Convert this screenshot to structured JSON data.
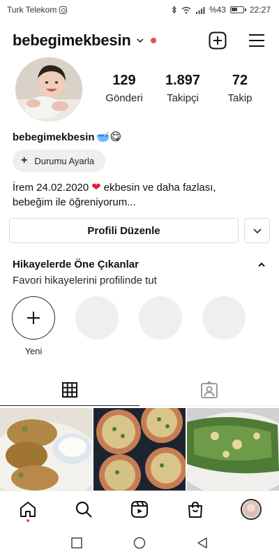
{
  "status_bar": {
    "carrier": "Turk Telekom",
    "battery": "%43",
    "time": "22:27"
  },
  "header": {
    "username": "bebegimekbesin"
  },
  "profile": {
    "stats": [
      {
        "value": "129",
        "label": "Gönderi"
      },
      {
        "value": "1.897",
        "label": "Takipçi"
      },
      {
        "value": "72",
        "label": "Takip"
      }
    ],
    "display_name": "bebegimekbesin",
    "display_emojis": "🥣😋",
    "status_button": "Durumu Ayarla",
    "bio_part1": "İrem 24.02.2020",
    "bio_heart": "❤",
    "bio_part2": "ekbesin ve daha fazlası,",
    "bio_line2": "bebeğim ile öğreniyorum...",
    "edit_profile_button": "Profili Düzenle"
  },
  "highlights": {
    "title": "Hikayelerde Öne Çıkanlar",
    "subtitle": "Favori hikayelerini profilinde tut",
    "new_label": "Yeni"
  },
  "tabs": [
    {
      "icon": "grid-icon"
    },
    {
      "icon": "tagged-icon"
    }
  ],
  "bottom_nav": [
    {
      "icon": "home-icon"
    },
    {
      "icon": "search-icon"
    },
    {
      "icon": "reels-icon"
    },
    {
      "icon": "shop-icon"
    },
    {
      "icon": "profile-avatar"
    }
  ],
  "colors": {
    "notification": "#ed4956",
    "heart": "#e01e2b"
  }
}
